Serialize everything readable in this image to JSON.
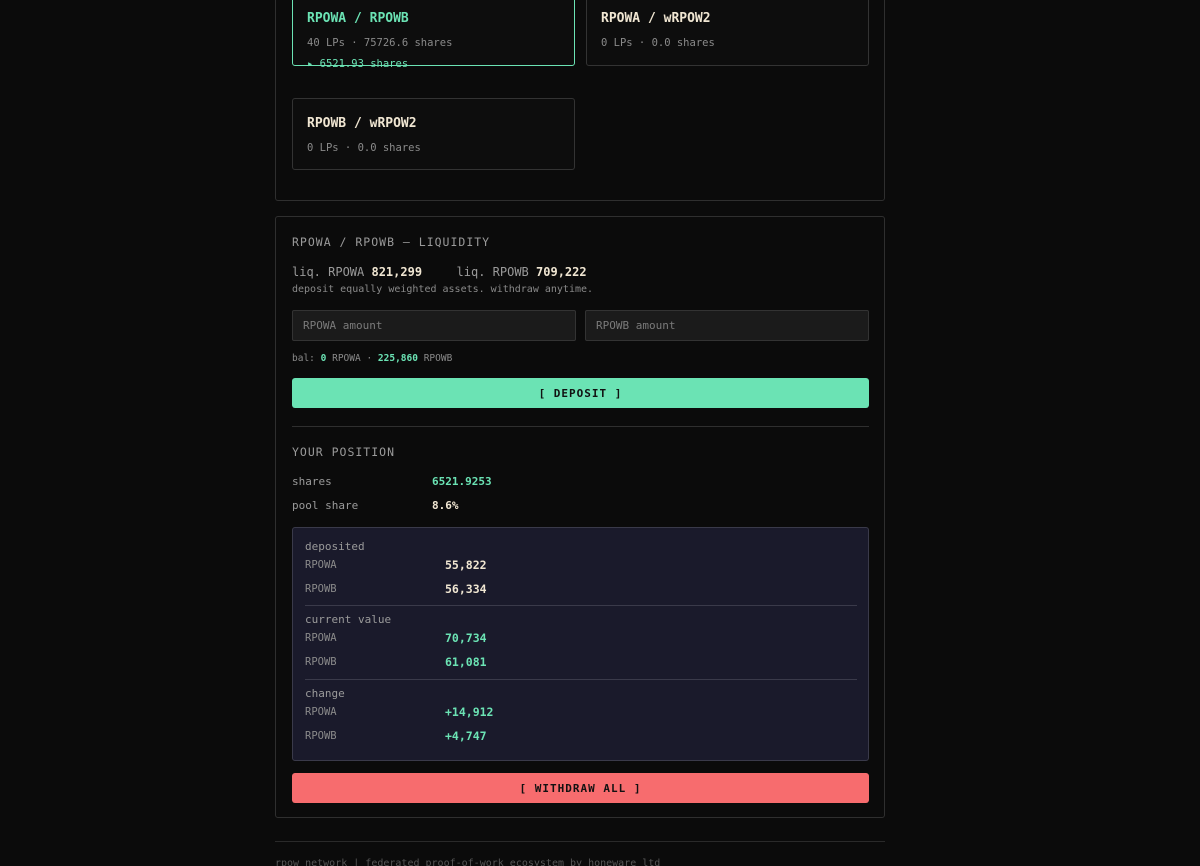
{
  "pools": [
    {
      "title": "RPOWA / RPOWB",
      "meta": "40 LPs · 75726.6 shares",
      "mine": "▸ 6521.93 shares",
      "active": true
    },
    {
      "title": "RPOWA / wRPOW2",
      "meta": "0 LPs · 0.0 shares"
    },
    {
      "title": "RPOWB / wRPOW2",
      "meta": "0 LPs · 0.0 shares"
    }
  ],
  "liquidity": {
    "heading": "RPOWA / RPOWB — LIQUIDITY",
    "liq_a_label": "liq. RPOWA",
    "liq_a_value": "821,299",
    "liq_b_label": "liq. RPOWB",
    "liq_b_value": "709,222",
    "note": "deposit equally weighted assets. withdraw anytime.",
    "input_a_placeholder": "RPOWA amount",
    "input_b_placeholder": "RPOWB amount",
    "bal_label": "bal:",
    "bal_a_value": "0",
    "bal_a_unit": "RPOWA",
    "bal_sep": "·",
    "bal_b_value": "225,860",
    "bal_b_unit": "RPOWB",
    "deposit_label": "[ DEPOSIT ]"
  },
  "position": {
    "heading": "YOUR POSITION",
    "shares_label": "shares",
    "shares_value": "6521.9253",
    "pool_share_label": "pool share",
    "pool_share_value": "8.6%",
    "deposited": {
      "label": "deposited",
      "rows": [
        {
          "asset": "RPOWA",
          "value": "55,822"
        },
        {
          "asset": "RPOWB",
          "value": "56,334"
        }
      ]
    },
    "current": {
      "label": "current value",
      "rows": [
        {
          "asset": "RPOWA",
          "value": "70,734"
        },
        {
          "asset": "RPOWB",
          "value": "61,081"
        }
      ]
    },
    "change": {
      "label": "change",
      "rows": [
        {
          "asset": "RPOWA",
          "value": "+14,912"
        },
        {
          "asset": "RPOWB",
          "value": "+4,747"
        }
      ]
    },
    "withdraw_label": "[ WITHDRAW ALL ]"
  },
  "footer": {
    "text": "rpow network | federated proof-of-work ecosystem by honeware ltd"
  },
  "colors": {
    "accent": "#6be3b4",
    "danger": "#f76c6e",
    "background": "#0b0b0b",
    "panel_inner": "#1a1a2b"
  }
}
